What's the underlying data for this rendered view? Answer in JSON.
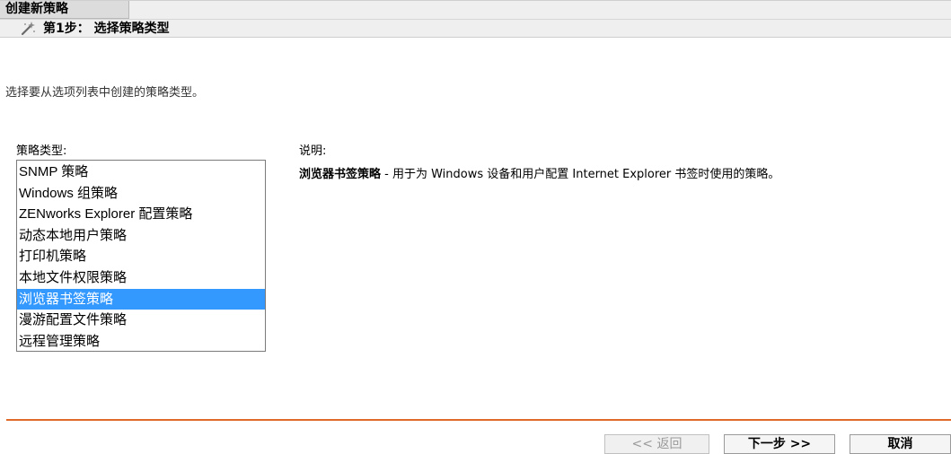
{
  "header": {
    "tab_label": "创建新策略",
    "step_title": "第1步： 选择策略类型",
    "step_icon": "wand-icon"
  },
  "intro": "选择要从选项列表中创建的策略类型。",
  "policy_types": {
    "label": "策略类型:",
    "items": [
      "SNMP 策略",
      "Windows 组策略",
      "ZENworks Explorer 配置策略",
      "动态本地用户策略",
      "打印机策略",
      "本地文件权限策略",
      "浏览器书签策略",
      "漫游配置文件策略",
      "远程管理策略"
    ],
    "selected": "浏览器书签策略"
  },
  "description": {
    "label": "说明:",
    "name": "浏览器书签策略",
    "text": " - 用于为 Windows 设备和用户配置 Internet Explorer 书签时使用的策略。"
  },
  "footer": {
    "back_label": "<< 返回",
    "next_label": "下一步 >>",
    "cancel_label": "取消"
  },
  "colors": {
    "divider": "#e06a2a",
    "selection": "#3399ff"
  }
}
